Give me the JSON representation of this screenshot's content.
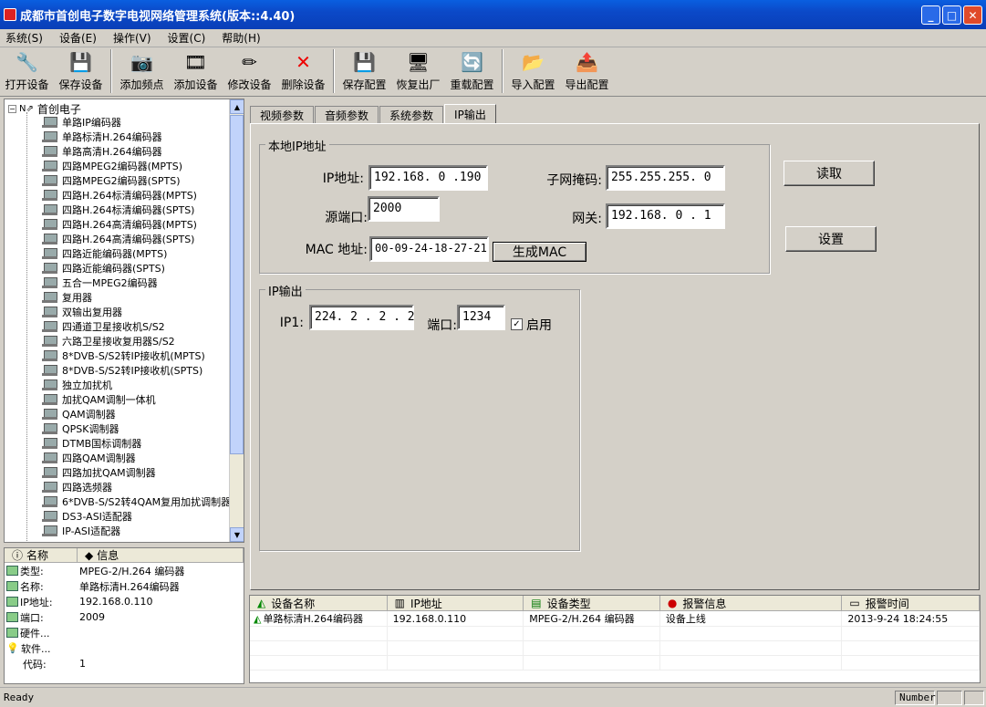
{
  "window": {
    "title": "成都市首创电子数字电视网络管理系统(版本::4.40)"
  },
  "menu": [
    "系统(S)",
    "设备(E)",
    "操作(V)",
    "设置(C)",
    "帮助(H)"
  ],
  "toolbar": [
    {
      "label": "打开设备",
      "icon": "open-device-icon"
    },
    {
      "label": "保存设备",
      "icon": "save-device-icon"
    },
    {
      "label": "添加频点",
      "icon": "add-frequency-icon"
    },
    {
      "label": "添加设备",
      "icon": "add-device-icon"
    },
    {
      "label": "修改设备",
      "icon": "edit-device-icon"
    },
    {
      "label": "删除设备",
      "icon": "delete-device-icon"
    },
    {
      "label": "保存配置",
      "icon": "save-config-icon"
    },
    {
      "label": "恢复出厂",
      "icon": "factory-reset-icon"
    },
    {
      "label": "重载配置",
      "icon": "reload-config-icon"
    },
    {
      "label": "导入配置",
      "icon": "import-config-icon"
    },
    {
      "label": "导出配置",
      "icon": "export-config-icon"
    }
  ],
  "tree": {
    "root": "首创电子",
    "items": [
      "单路IP编码器",
      "单路标清H.264编码器",
      "单路高清H.264编码器",
      "四路MPEG2编码器(MPTS)",
      "四路MPEG2编码器(SPTS)",
      "四路H.264标清编码器(MPTS)",
      "四路H.264标清编码器(SPTS)",
      "四路H.264高清编码器(MPTS)",
      "四路H.264高清编码器(SPTS)",
      "四路近能编码器(MPTS)",
      "四路近能编码器(SPTS)",
      "五合一MPEG2编码器",
      "复用器",
      "双输出复用器",
      "四通道卫星接收机S/S2",
      "六路卫星接收复用器S/S2",
      "8*DVB-S/S2转IP接收机(MPTS)",
      "8*DVB-S/S2转IP接收机(SPTS)",
      "独立加扰机",
      "加扰QAM调制一体机",
      "QAM调制器",
      "QPSK调制器",
      "DTMB国标调制器",
      "四路QAM调制器",
      "四路加扰QAM调制器",
      "四路选频器",
      "6*DVB-S/S2转4QAM复用加扰调制器",
      "DS3-ASI适配器",
      "IP-ASI适配器"
    ]
  },
  "info": {
    "headers": [
      "名称",
      "信息"
    ],
    "rows": [
      {
        "k": "类型:",
        "v": "MPEG-2/H.264 编码器"
      },
      {
        "k": "名称:",
        "v": "单路标清H.264编码器"
      },
      {
        "k": "IP地址:",
        "v": "192.168.0.110"
      },
      {
        "k": "端口:",
        "v": "2009"
      },
      {
        "k": "硬件...",
        "v": ""
      },
      {
        "k": "软件...",
        "v": ""
      },
      {
        "k": "代码:",
        "v": "1"
      }
    ]
  },
  "tabs": [
    "视频参数",
    "音频参数",
    "系统参数",
    "IP输出"
  ],
  "local_ip": {
    "title": "本地IP地址",
    "ip_label": "IP地址:",
    "ip": "192.168. 0 .190",
    "mask_label": "子网掩码:",
    "mask": "255.255.255. 0",
    "port_label": "源端口:",
    "port": "2000",
    "gw_label": "网关:",
    "gw": "192.168. 0 . 1",
    "mac_label": "MAC 地址:",
    "mac": "00-09-24-18-27-21",
    "gen_mac": "生成MAC"
  },
  "ip_out": {
    "title": "IP输出",
    "ip1_label": "IP1:",
    "ip1": "224. 2 . 2 . 2",
    "port_label": "端口:",
    "port": "1234",
    "enable": "启用",
    "enabled": true
  },
  "buttons": {
    "read": "读取",
    "set": "设置"
  },
  "log": {
    "headers": [
      "设备名称",
      "IP地址",
      "设备类型",
      "报警信息",
      "报警时间"
    ],
    "rows": [
      [
        "单路标清H.264编码器",
        "192.168.0.110",
        "MPEG-2/H.264 编码器",
        "设备上线",
        "2013-9-24 18:24:55"
      ]
    ]
  },
  "status": {
    "text": "Ready",
    "num": "Number"
  }
}
